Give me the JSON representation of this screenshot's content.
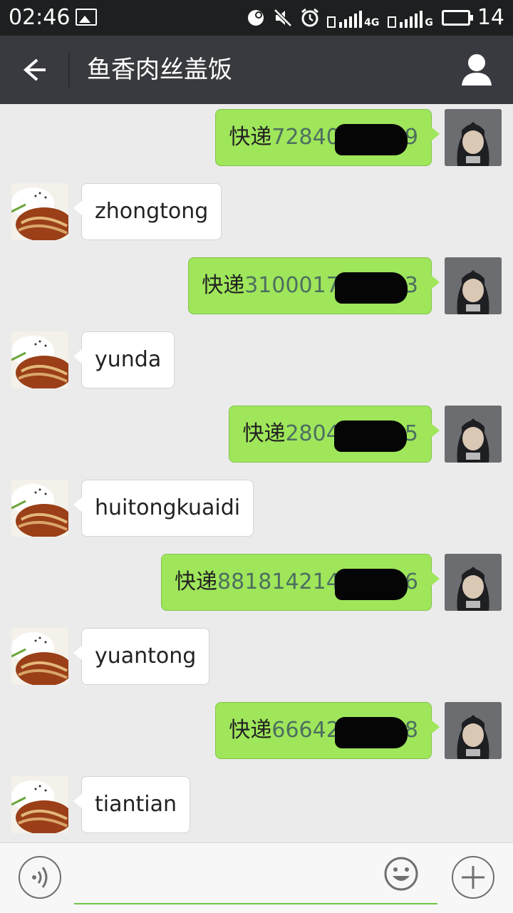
{
  "status_bar": {
    "time": "02:46",
    "battery": "14",
    "network_1": "4G",
    "network_2": "G",
    "icons": [
      "image-icon",
      "headset-icon",
      "mute-icon",
      "alarm-icon",
      "signal-icon",
      "battery-icon"
    ]
  },
  "header": {
    "title": "鱼香肉丝盖饭",
    "icons": [
      "back-arrow-icon",
      "profile-icon"
    ]
  },
  "messages": [
    {
      "sender": "me",
      "prefix": "快递",
      "number": "728405",
      "tail": "9"
    },
    {
      "sender": "other",
      "text": "zhongtong"
    },
    {
      "sender": "me",
      "prefix": "快递",
      "number": "31000179",
      "tail": "3"
    },
    {
      "sender": "other",
      "text": "yunda"
    },
    {
      "sender": "me",
      "prefix": "快递",
      "number": "28047",
      "tail": "5"
    },
    {
      "sender": "other",
      "text": "huitongkuaidi"
    },
    {
      "sender": "me",
      "prefix": "快递",
      "number": "8818142147",
      "tail": "6"
    },
    {
      "sender": "other",
      "text": "yuantong"
    },
    {
      "sender": "me",
      "prefix": "快递",
      "number": "666423",
      "tail": "8"
    },
    {
      "sender": "other",
      "text": "tiantian"
    }
  ],
  "input": {
    "value": "",
    "placeholder": "",
    "icons": [
      "voice-icon",
      "emoji-icon",
      "plus-icon"
    ]
  },
  "colors": {
    "status_bar": "#1d1f20",
    "title_bar": "#393a3f",
    "chat_bg": "#ebebeb",
    "bubble_me": "#9fe65b",
    "bubble_other": "#ffffff",
    "number_text": "#4d6f5f",
    "input_underline": "#6cc644"
  }
}
